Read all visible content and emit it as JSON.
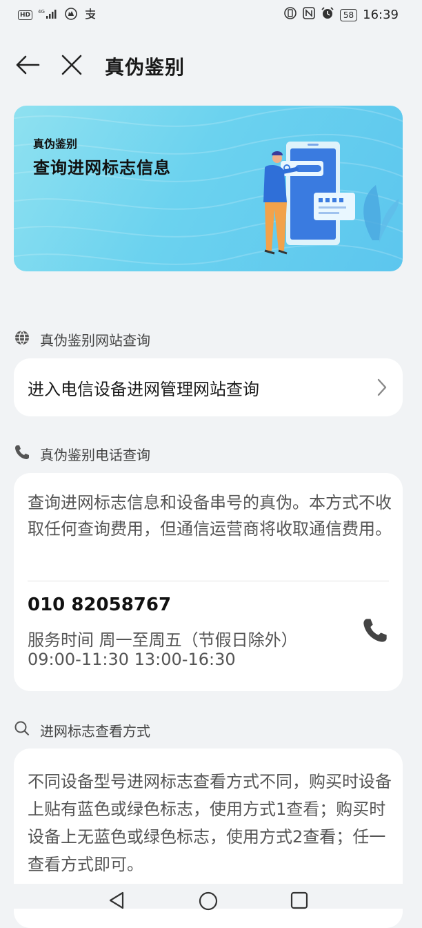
{
  "status_bar": {
    "hd": "HD",
    "network": "4G",
    "battery": "58",
    "time": "16:39",
    "icons": [
      "hd-icon",
      "signal-icon",
      "app-icon",
      "alipay-icon",
      "vibrate-icon",
      "nfc-icon",
      "alarm-icon",
      "battery-icon"
    ]
  },
  "header": {
    "title": "真伪鉴别",
    "back_icon": "arrow-left-icon",
    "close_icon": "close-icon"
  },
  "banner": {
    "small_title": "真伪鉴别",
    "big_title": "查询进网标志信息"
  },
  "website_section": {
    "label": "真伪鉴别网站查询",
    "icon": "globe-icon",
    "link_text": "进入电信设备进网管理网站查询"
  },
  "phone_section": {
    "label": "真伪鉴别电话查询",
    "icon": "phone-icon",
    "description": "查询进网标志信息和设备串号的真伪。本方式不收取任何查询费用，但通信运营商将收取通信费用。",
    "phone_number": "010 82058767",
    "hours_line1": "服务时间 周一至周五（节假日除外）",
    "hours_line2": "09:00-11:30 13:00-16:30"
  },
  "view_section": {
    "label": "进网标志查看方式",
    "icon": "search-icon",
    "description": "不同设备型号进网标志查看方式不同，购买时设备上贴有蓝色或绿色标志，使用方式1查看；购买时设备上无蓝色或绿色标志，使用方式2查看；任一查看方式即可。"
  },
  "nav_bar": {
    "icons": [
      "nav-back-icon",
      "nav-home-icon",
      "nav-recents-icon"
    ]
  },
  "colors": {
    "background": "#f1f3f5",
    "card": "#ffffff",
    "banner_start": "#8fe1f0",
    "banner_end": "#5cc6ee",
    "accent_blue": "#3a7be0"
  }
}
